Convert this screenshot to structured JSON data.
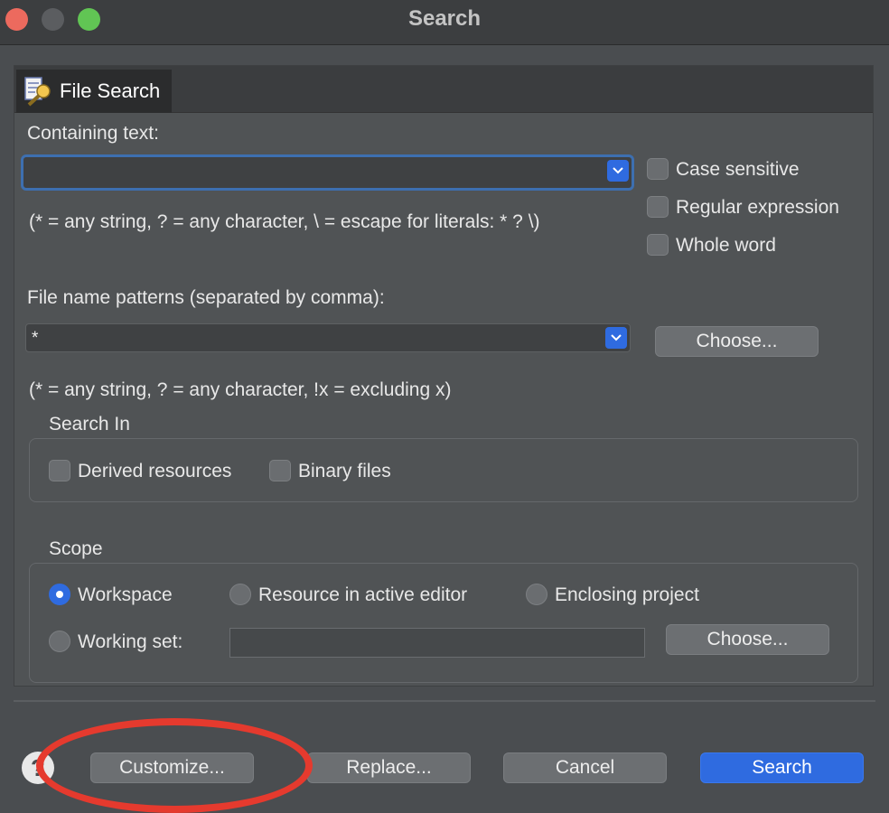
{
  "window": {
    "title": "Search"
  },
  "tab": {
    "label": "File Search",
    "icon": "file-search-icon"
  },
  "containing_text": {
    "label": "Containing text:",
    "value": "",
    "hint": "(* = any string, ? = any character, \\ = escape for literals: * ? \\)"
  },
  "options": {
    "case_sensitive": "Case sensitive",
    "regular_expression": "Regular expression",
    "whole_word": "Whole word"
  },
  "file_patterns": {
    "label": "File name patterns (separated by comma):",
    "value": "*",
    "choose_label": "Choose...",
    "hint": "(* = any string, ? = any character, !x = excluding x)"
  },
  "search_in": {
    "title": "Search In",
    "derived_resources": "Derived resources",
    "binary_files": "Binary files"
  },
  "scope": {
    "title": "Scope",
    "workspace": "Workspace",
    "active_editor": "Resource in active editor",
    "enclosing_project": "Enclosing project",
    "working_set": "Working set:",
    "working_set_value": "",
    "choose_label": "Choose...",
    "selected": "Workspace"
  },
  "buttons": {
    "help": "?",
    "customize": "Customize...",
    "replace": "Replace...",
    "cancel": "Cancel",
    "search": "Search"
  },
  "colors": {
    "accent": "#2f6be0",
    "annotation": "#e53a2e"
  }
}
